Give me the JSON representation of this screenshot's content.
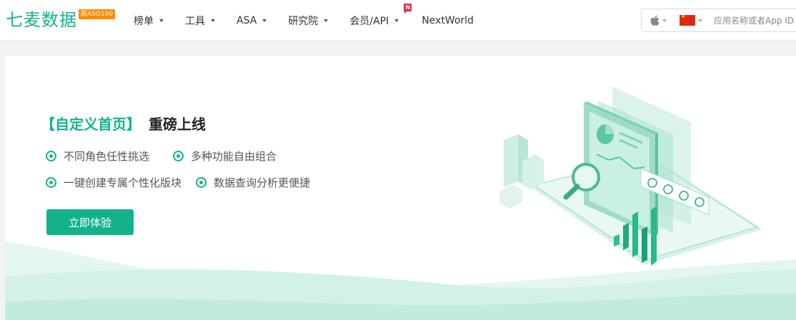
{
  "header": {
    "logo": {
      "text": "七麦数据",
      "badge": "原ASO100"
    },
    "nav": [
      {
        "label": "榜单",
        "dropdown": true
      },
      {
        "label": "工具",
        "dropdown": true
      },
      {
        "label": "ASA",
        "dropdown": true
      },
      {
        "label": "研究院",
        "dropdown": true
      },
      {
        "label": "会员/API",
        "dropdown": true,
        "badge": "N"
      },
      {
        "label": "NextWorld",
        "dropdown": false
      }
    ],
    "search": {
      "platform_icon": "apple-icon",
      "country_flag": "china-flag-icon",
      "placeholder": "应用名称或者App ID"
    }
  },
  "banner": {
    "title_highlight": "【自定义首页】",
    "title_rest": "重磅上线",
    "features": [
      [
        "不同角色任性挑选",
        "多种功能自由组合"
      ],
      [
        "一键创建专属个性化版块",
        "数据查询分析更便捷"
      ]
    ],
    "cta_label": "立即体验"
  },
  "colors": {
    "brand": "#12b38c",
    "badge_orange": "#ff8a00",
    "new_badge_red": "#f0283c",
    "page_bg": "#f2f3f5"
  }
}
